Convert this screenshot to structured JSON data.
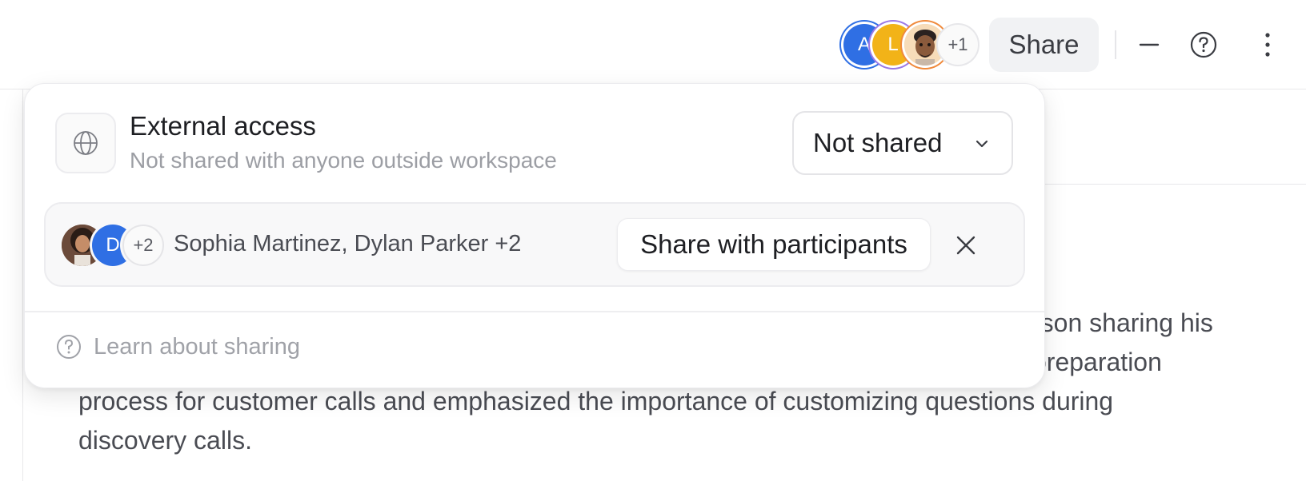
{
  "header": {
    "avatars": [
      {
        "initial": "A",
        "color": "#2f6fe4"
      },
      {
        "initial": "L",
        "color": "#f2b318"
      },
      {
        "initial": "",
        "color": "#f6d6b0"
      }
    ],
    "more_avatars": "+1",
    "share_label": "Share",
    "icons": [
      "minimize-icon",
      "help-circle-icon",
      "more-vertical-icon"
    ]
  },
  "content": {
    "paragraph_lines": [
      "rson sharing his",
      "oreparation",
      "process for customer calls and emphasized the importance of customizing questions during",
      "discovery calls."
    ]
  },
  "popover": {
    "external": {
      "title": "External access",
      "subtitle": "Not shared with anyone outside workspace",
      "icon": "globe-icon",
      "select_value": "Not shared"
    },
    "participants": {
      "avatar_d": "D",
      "more": "+2",
      "names": "Sophia Martinez, Dylan Parker +2",
      "action_label": "Share with participants"
    },
    "footer": {
      "learn_label": "Learn about sharing"
    }
  }
}
